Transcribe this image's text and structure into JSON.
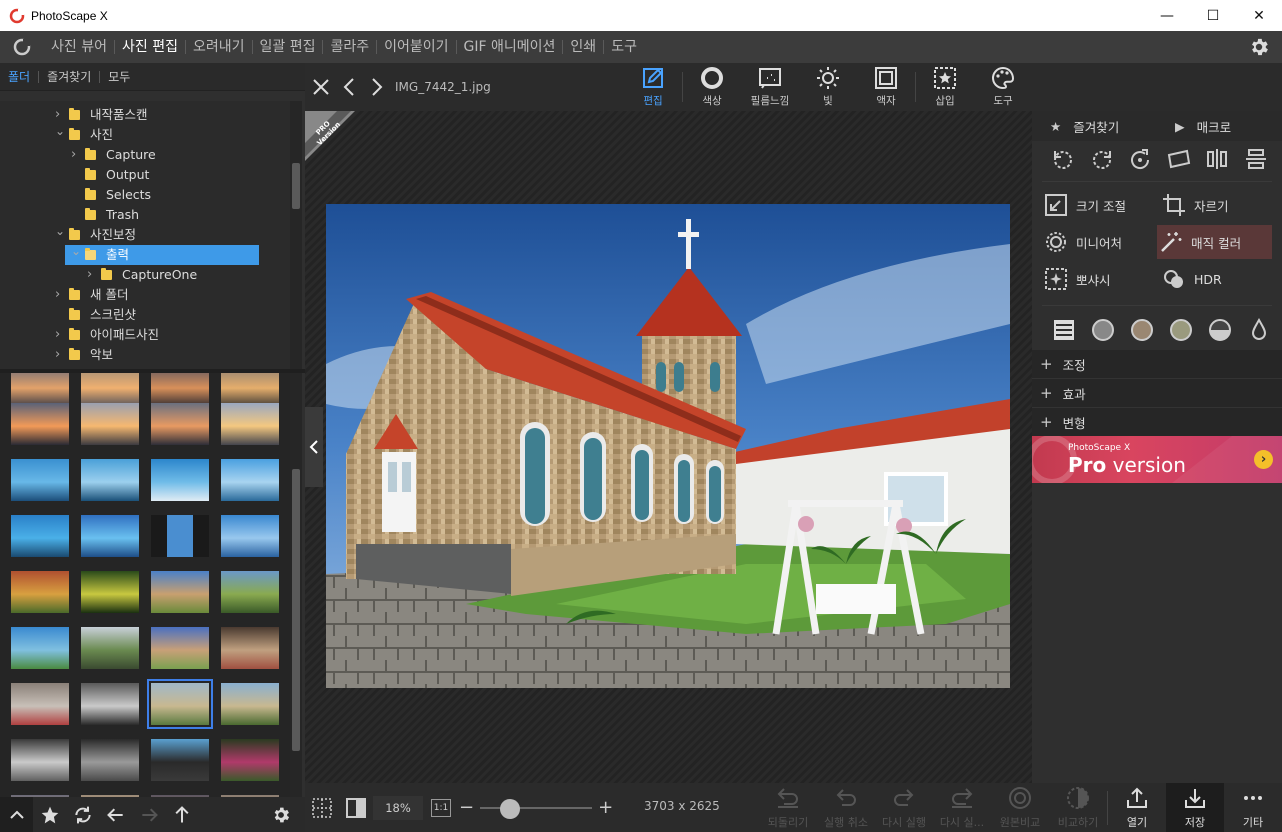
{
  "window": {
    "title": "PhotoScape X",
    "minimize": "—",
    "maximize": "☐",
    "close": "✕"
  },
  "menu": {
    "items": [
      "사진 뷰어",
      "사진 편집",
      "오려내기",
      "일괄 편집",
      "콜라주",
      "이어붙이기",
      "GIF 애니메이션",
      "인쇄",
      "도구"
    ],
    "active_index": 1
  },
  "left_tabs": [
    "폴더",
    "즐겨찾기",
    "모두"
  ],
  "tree": [
    {
      "label": "내작품스캔",
      "level": 0,
      "expanded": false
    },
    {
      "label": "사진",
      "level": 0,
      "expanded": true
    },
    {
      "label": "Capture",
      "level": 1,
      "expanded": false
    },
    {
      "label": "Output",
      "level": 1,
      "leaf": true
    },
    {
      "label": "Selects",
      "level": 1,
      "leaf": true
    },
    {
      "label": "Trash",
      "level": 1,
      "leaf": true
    },
    {
      "label": "사진보정",
      "level": 0,
      "expanded": true
    },
    {
      "label": "출력",
      "level": 1,
      "expanded": true,
      "selected": true
    },
    {
      "label": "CaptureOne",
      "level": 2,
      "expanded": false
    },
    {
      "label": "새 폴더",
      "level": 0,
      "expanded": false
    },
    {
      "label": "스크린샷",
      "level": 0,
      "leaf": true
    },
    {
      "label": "아이패드사진",
      "level": 0,
      "expanded": false
    },
    {
      "label": "악보",
      "level": 0,
      "expanded": false
    }
  ],
  "editor": {
    "filename": "IMG_7442_1.jpg",
    "pro_ribbon": "PRO Version",
    "tools": [
      {
        "label": "편집",
        "icon": "edit-icon",
        "active": true
      },
      {
        "label": "색상",
        "icon": "color-icon"
      },
      {
        "label": "필름느낌",
        "icon": "film-icon"
      },
      {
        "label": "빛",
        "icon": "light-icon"
      },
      {
        "label": "액자",
        "icon": "frame-icon"
      },
      {
        "label": "삽입",
        "icon": "insert-icon"
      },
      {
        "label": "도구",
        "icon": "palette-icon"
      }
    ]
  },
  "right_panel": {
    "tabs": [
      {
        "label": "즐겨찾기",
        "icon": "star-icon"
      },
      {
        "label": "매크로",
        "icon": "play-icon"
      }
    ],
    "features": [
      [
        "크기 조절",
        "자르기"
      ],
      [
        "미니어처",
        "매직 컬러"
      ],
      [
        "뽀샤시",
        "HDR"
      ]
    ],
    "highlighted_feature": "매직 컬러",
    "sections": [
      "조정",
      "효과",
      "변형"
    ],
    "banner": {
      "small": "PhotoScape X",
      "big_bold": "Pro",
      "big_rest": " version",
      "go": "›"
    }
  },
  "status": {
    "zoom": "18%",
    "ratio_label": "1:1",
    "zoom_minus": "−",
    "zoom_plus": "+",
    "zoom_fraction": 0.18,
    "dimensions": "3703 x 2625"
  },
  "actions": [
    {
      "label": "되돌리기",
      "enabled": false
    },
    {
      "label": "실행 취소",
      "enabled": false
    },
    {
      "label": "다시 실행",
      "enabled": false
    },
    {
      "label": "다시 실...",
      "enabled": false
    },
    {
      "label": "원본비교",
      "enabled": false
    },
    {
      "label": "비교하기",
      "enabled": false
    },
    {
      "label": "열기",
      "enabled": true
    },
    {
      "label": "저장",
      "enabled": true
    },
    {
      "label": "기타",
      "enabled": true
    }
  ]
}
